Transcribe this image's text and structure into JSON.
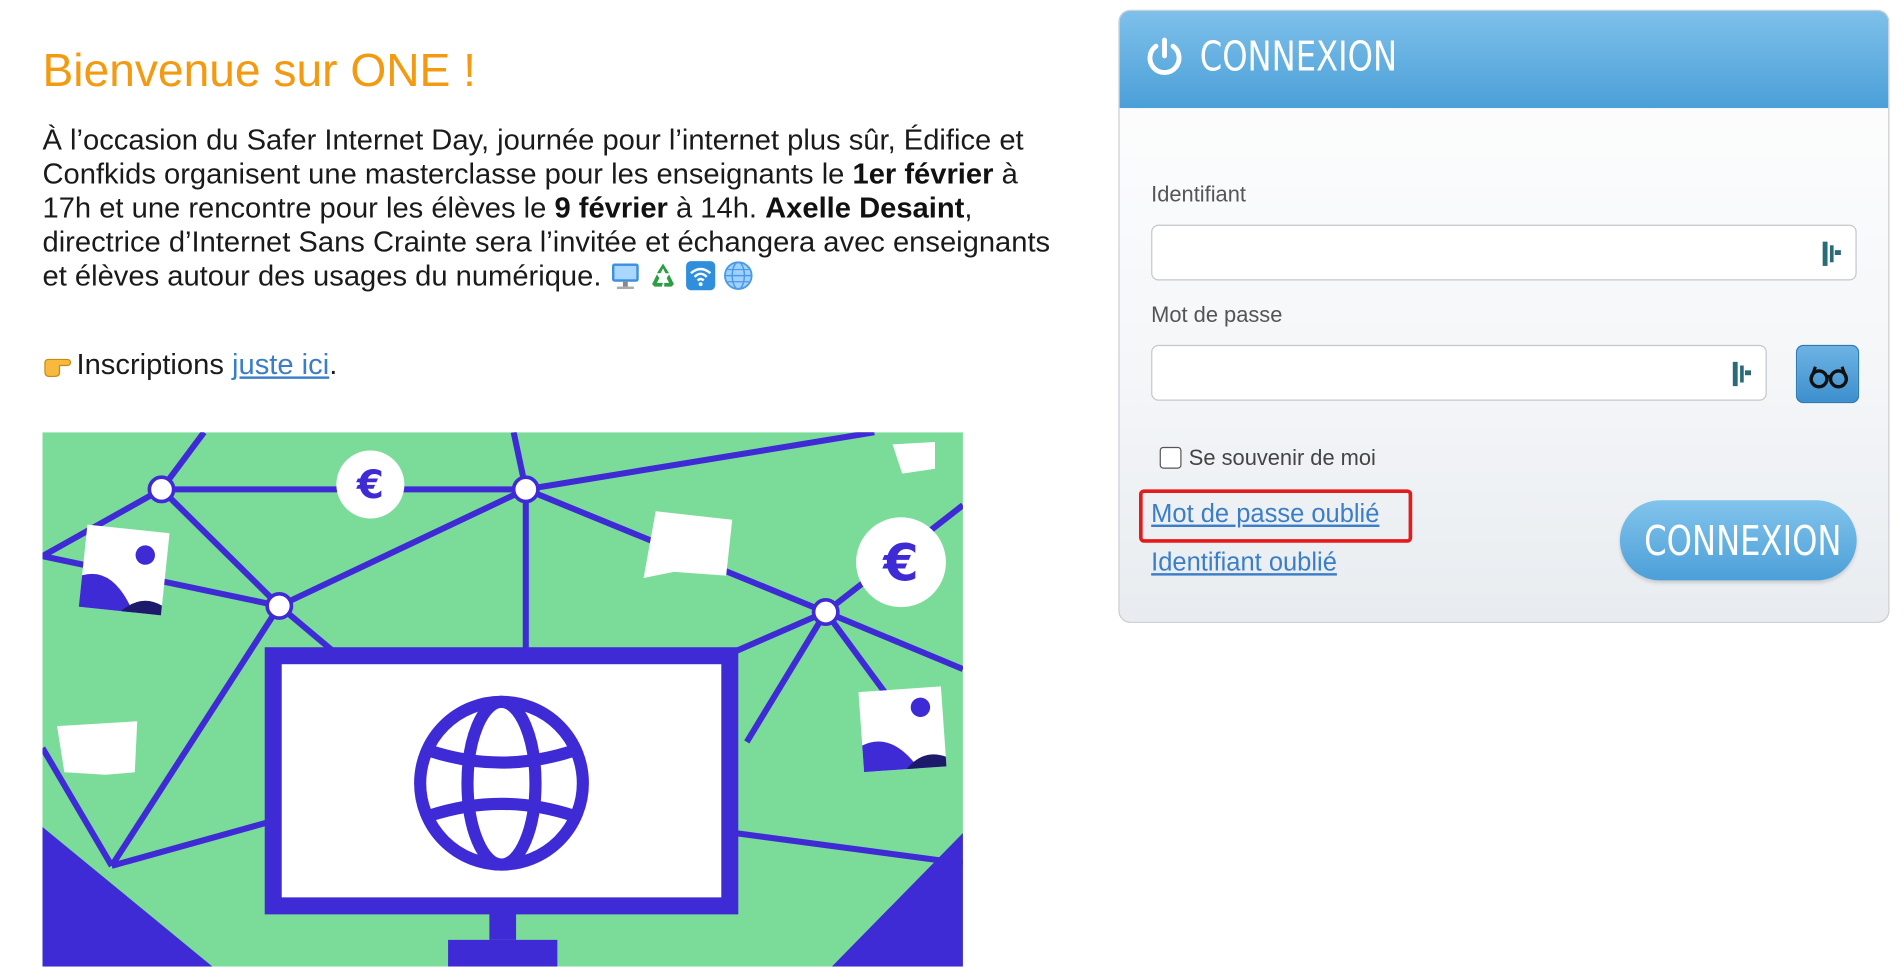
{
  "welcome": {
    "title": "Bienvenue sur ONE !",
    "intro_parts": [
      "À l’occasion du Safer Internet Day, journée pour l’internet plus sûr, Édifice et Confkids organisent une masterclasse pour les enseignants le ",
      "1er février",
      " à 17h et une rencontre pour les élèves le ",
      "9 février",
      " à 14h. ",
      "Axelle Desaint",
      ", directrice d’Internet Sans Crainte sera l’invitée et échangera avec enseignants et élèves autour des usages du numérique. "
    ],
    "emoji_icons": [
      "computer-icon",
      "recycle-icon",
      "wifi-icon",
      "globe-icon"
    ],
    "signup_prefix": "Inscriptions ",
    "signup_link": "juste ici",
    "signup_suffix": "."
  },
  "login": {
    "header_title": "CONNEXION",
    "identifier_label": "Identifiant",
    "identifier_value": "",
    "password_label": "Mot de passe",
    "password_value": "",
    "remember_label": "Se souvenir de moi",
    "remember_checked": false,
    "forgot_password_link": "Mot de passe oublié",
    "forgot_identifier_link": "Identifiant oublié",
    "submit_label": "CONNEXION"
  },
  "colors": {
    "title_orange": "#f39a10",
    "link_blue": "#3a7ec8",
    "header_blue": "#4b9fd8",
    "highlight_red": "#e31b1b",
    "hero_green": "#7bdc9a",
    "hero_purple": "#3f2bd6"
  }
}
